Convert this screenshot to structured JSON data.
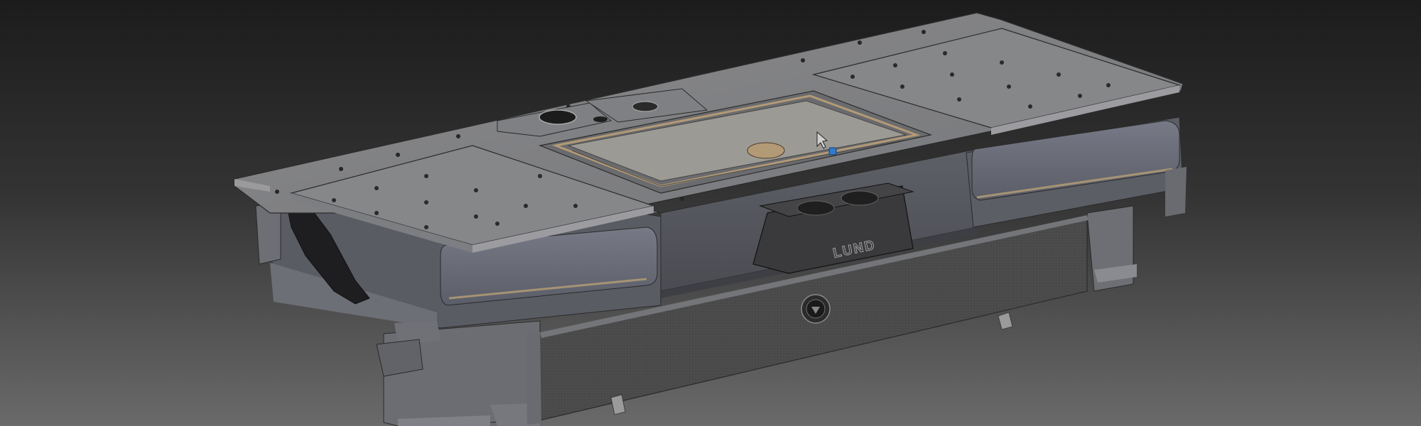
{
  "viewport": {
    "background_top": "#1c1c1c",
    "background_bottom": "#6a6a6a"
  },
  "model": {
    "brand_label": "LUND",
    "panel_color": "#8e8e8e",
    "body_color": "#5a5c63",
    "carpet_color": "#4a4a4a",
    "console_color": "#3a3a3c",
    "wood_color": "#b39a76",
    "selection_marker_color": "#2f7bd0"
  },
  "cursor": {
    "icon": "pointer-arrow-icon"
  }
}
